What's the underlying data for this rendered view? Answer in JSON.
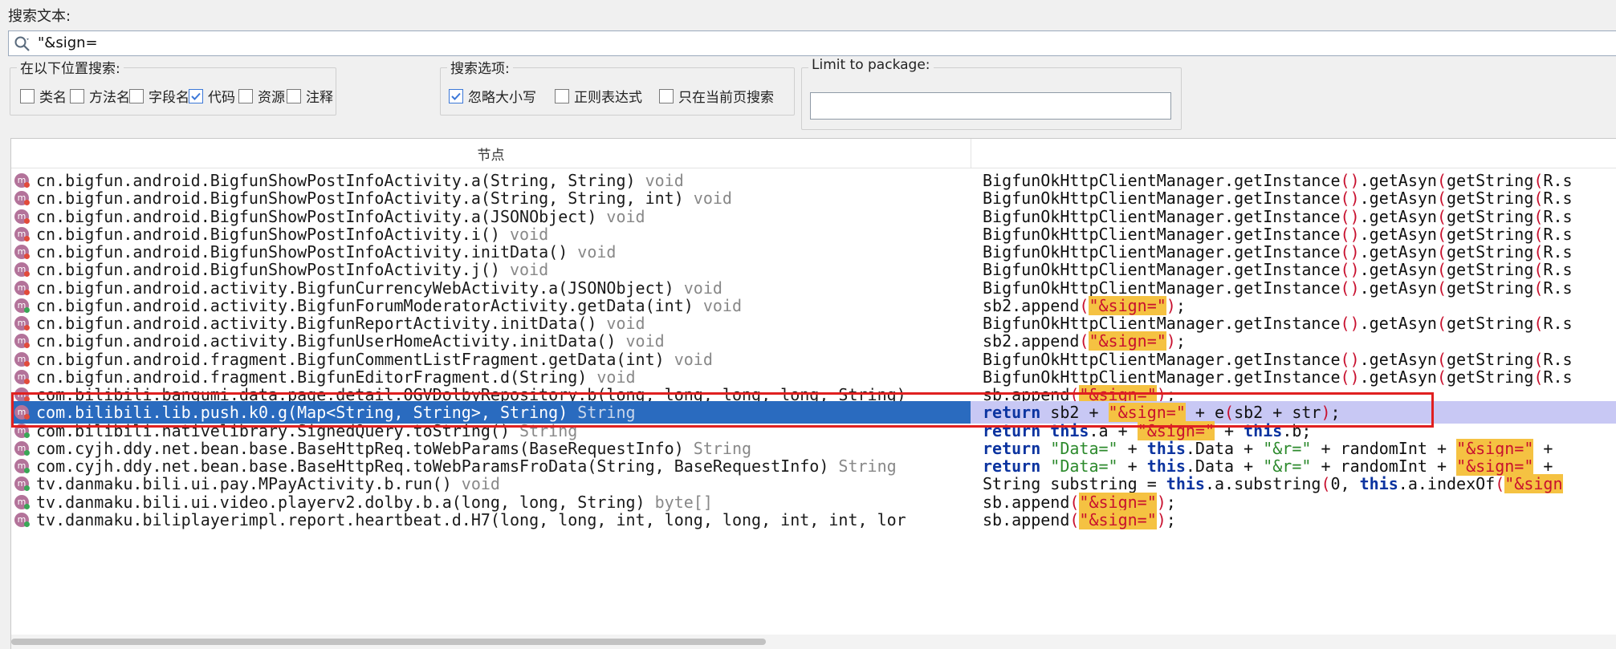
{
  "search": {
    "label": "搜索文本:",
    "value": "\"&sign="
  },
  "groups": {
    "location": {
      "legend": "在以下位置搜索:",
      "options": [
        {
          "label": "类名",
          "checked": false
        },
        {
          "label": "方法名",
          "checked": false
        },
        {
          "label": "字段名",
          "checked": false
        },
        {
          "label": "代码",
          "checked": true
        },
        {
          "label": "资源",
          "checked": false
        },
        {
          "label": "注释",
          "checked": false
        }
      ]
    },
    "options": {
      "legend": "搜索选项:",
      "options": [
        {
          "label": "忽略大小写",
          "checked": true
        },
        {
          "label": "正则表达式",
          "checked": false
        },
        {
          "label": "只在当前页搜索",
          "checked": false
        }
      ]
    },
    "package": {
      "legend": "Limit to package:",
      "value": ""
    }
  },
  "table": {
    "node_header": "节点",
    "rows": [
      {
        "sig": "cn.bigfun.android.BigfunShowPostInfoActivity.a(String, String)",
        "ret": " void",
        "dot": "red",
        "code": "BigfunOkHttpClientManager.getInstance().getAsyn(getString(R.s"
      },
      {
        "sig": "cn.bigfun.android.BigfunShowPostInfoActivity.a(String, String, int)",
        "ret": " void",
        "dot": "red",
        "code": "BigfunOkHttpClientManager.getInstance().getAsyn(getString(R.s"
      },
      {
        "sig": "cn.bigfun.android.BigfunShowPostInfoActivity.a(JSONObject)",
        "ret": " void",
        "dot": "red",
        "code": "BigfunOkHttpClientManager.getInstance().getAsyn(getString(R.s"
      },
      {
        "sig": "cn.bigfun.android.BigfunShowPostInfoActivity.i()",
        "ret": " void",
        "dot": "red",
        "code": "BigfunOkHttpClientManager.getInstance().getAsyn(getString(R.s"
      },
      {
        "sig": "cn.bigfun.android.BigfunShowPostInfoActivity.initData()",
        "ret": " void",
        "dot": "red",
        "code": "BigfunOkHttpClientManager.getInstance().getAsyn(getString(R.s"
      },
      {
        "sig": "cn.bigfun.android.BigfunShowPostInfoActivity.j()",
        "ret": " void",
        "dot": "red",
        "code": "BigfunOkHttpClientManager.getInstance().getAsyn(getString(R.s"
      },
      {
        "sig": "cn.bigfun.android.activity.BigfunCurrencyWebActivity.a(JSONObject)",
        "ret": " void",
        "dot": "red",
        "code": "BigfunOkHttpClientManager.getInstance().getAsyn(getString(R.s"
      },
      {
        "sig": "cn.bigfun.android.activity.BigfunForumModeratorActivity.getData(int)",
        "ret": " void",
        "dot": "green",
        "code": "sb2.append(\"&sign=\");"
      },
      {
        "sig": "cn.bigfun.android.activity.BigfunReportActivity.initData()",
        "ret": " void",
        "dot": "red",
        "code": "BigfunOkHttpClientManager.getInstance().getAsyn(getString(R.s"
      },
      {
        "sig": "cn.bigfun.android.activity.BigfunUserHomeActivity.initData()",
        "ret": " void",
        "dot": "red",
        "code": "sb2.append(\"&sign=\");"
      },
      {
        "sig": "cn.bigfun.android.fragment.BigfunCommentListFragment.getData(int)",
        "ret": " void",
        "dot": "red",
        "code": "BigfunOkHttpClientManager.getInstance().getAsyn(getString(R.s"
      },
      {
        "sig": "cn.bigfun.android.fragment.BigfunEditorFragment.d(String)",
        "ret": " void",
        "dot": "red",
        "code": "BigfunOkHttpClientManager.getInstance().getAsyn(getString(R.s"
      },
      {
        "sig": "com.bilibili.bangumi.data.page.detail.OGVDolbyRepository.b(long, long, long, long, String)",
        "ret": "",
        "dot": "red",
        "code": "sb.append(\"&sign=\");"
      },
      {
        "sig": "com.bilibili.lib.push.k0.g(Map<String, String>, String)",
        "ret": " String",
        "dot": "red",
        "code": "return sb2 + \"&sign=\" + e(sb2 + str);",
        "selected": true
      },
      {
        "sig": "com.bilibili.nativelibrary.SignedQuery.toString()",
        "ret": " String",
        "dot": "green",
        "code": "return this.a + \"&sign=\" + this.b;"
      },
      {
        "sig": "com.cyjh.ddy.net.bean.base.BaseHttpReq.toWebParams(BaseRequestInfo)",
        "ret": " String",
        "dot": "green",
        "code": "return \"Data=\" + this.Data + \"&r=\" + randomInt + \"&sign=\" +"
      },
      {
        "sig": "com.cyjh.ddy.net.bean.base.BaseHttpReq.toWebParamsFroData(String, BaseRequestInfo)",
        "ret": " String",
        "dot": "green",
        "code": "return \"Data=\" + this.Data + \"&r=\" + randomInt + \"&sign=\" +"
      },
      {
        "sig": "tv.danmaku.bili.ui.pay.MPayActivity.b.run()",
        "ret": " void",
        "dot": "green",
        "code": "String substring = this.a.substring(0, this.a.indexOf(\"&sign"
      },
      {
        "sig": "tv.danmaku.bili.ui.video.playerv2.dolby.b.a(long, long, String)",
        "ret": " byte[]",
        "dot": "green",
        "code": "sb.append(\"&sign=\");"
      },
      {
        "sig": "tv.danmaku.biliplayerimpl.report.heartbeat.d.H7(long, long, int, long, long, int, int, lor",
        "ret": "",
        "dot": "green",
        "code": "sb.append(\"&sign=\");"
      }
    ]
  },
  "icons": {
    "search": "search-icon",
    "method": "method-icon",
    "checkbox": "checkbox-check-icon"
  },
  "colors": {
    "selection": "#2a6bbf",
    "highlight": "#f5c242",
    "keyword": "#0c34a0",
    "annotation_box": "#e02020"
  }
}
